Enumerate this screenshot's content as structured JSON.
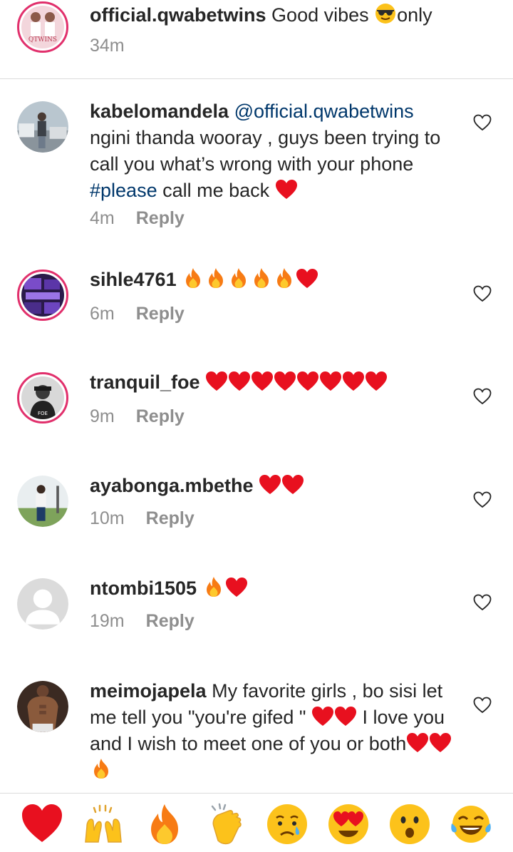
{
  "caption": {
    "username": "official.qwabetwins",
    "text_before": " Good vibes ",
    "emoji": "sunglasses-emoji",
    "text_after": "only",
    "time": "34m",
    "avatar_text": "QTWINS"
  },
  "comments": [
    {
      "username": "kabelomandela",
      "mention": "@official.qwabetwins",
      "text_a": "ngini thanda wooray ,  guys been trying to call you what’s wrong with your phone ",
      "hashtag": "#please",
      "text_b": " call me back ",
      "emojis": [
        "heart-emoji"
      ],
      "time": "4m",
      "reply_label": "Reply"
    },
    {
      "username": "sihle4761",
      "emojis": [
        "fire-emoji",
        "fire-emoji",
        "fire-emoji",
        "fire-emoji",
        "fire-emoji",
        "heart-emoji"
      ],
      "time": "6m",
      "reply_label": "Reply"
    },
    {
      "username": "tranquil_foe",
      "emojis": [
        "heart-emoji",
        "heart-emoji",
        "heart-emoji",
        "heart-emoji",
        "heart-emoji",
        "heart-emoji",
        "heart-emoji",
        "heart-emoji"
      ],
      "time": "9m",
      "reply_label": "Reply",
      "avatar_text": "FOE"
    },
    {
      "username": "ayabonga.mbethe",
      "emojis": [
        "heart-emoji",
        "heart-emoji"
      ],
      "time": "10m",
      "reply_label": "Reply"
    },
    {
      "username": "ntombi1505",
      "emojis": [
        "fire-emoji",
        "heart-emoji"
      ],
      "time": "19m",
      "reply_label": "Reply"
    },
    {
      "username": "meimojapela",
      "text_a": " My favorite girls , bo sisi let me tell you \"you're gifed \" ",
      "text_b": " I love you and I wish to meet one of you or both",
      "emojis_mid": [
        "heart-emoji",
        "heart-emoji"
      ],
      "emojis_end": [
        "heart-emoji",
        "heart-emoji",
        "fire-emoji"
      ]
    }
  ],
  "reactions": [
    "heart-emoji",
    "raising-hands-emoji",
    "fire-emoji",
    "clapping-hands-emoji",
    "crying-face-emoji",
    "heart-eyes-emoji",
    "surprised-face-emoji",
    "tears-of-joy-emoji"
  ],
  "colors": {
    "heart": "#e8101f",
    "fire": "#f77b14",
    "mention": "#00376b",
    "muted": "#8e8e8e",
    "ring": "#e1306c"
  }
}
